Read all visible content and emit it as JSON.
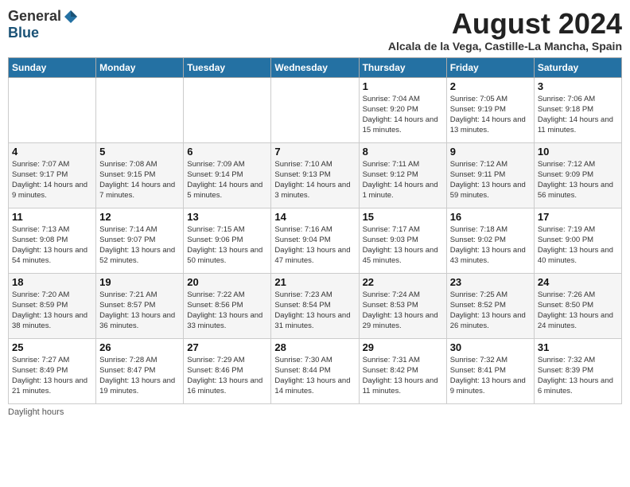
{
  "header": {
    "logo_general": "General",
    "logo_blue": "Blue",
    "month_title": "August 2024",
    "subtitle": "Alcala de la Vega, Castille-La Mancha, Spain"
  },
  "days_of_week": [
    "Sunday",
    "Monday",
    "Tuesday",
    "Wednesday",
    "Thursday",
    "Friday",
    "Saturday"
  ],
  "footer": {
    "note": "Daylight hours"
  },
  "weeks": [
    [
      {
        "day": "",
        "info": ""
      },
      {
        "day": "",
        "info": ""
      },
      {
        "day": "",
        "info": ""
      },
      {
        "day": "",
        "info": ""
      },
      {
        "day": "1",
        "info": "Sunrise: 7:04 AM\nSunset: 9:20 PM\nDaylight: 14 hours\nand 15 minutes."
      },
      {
        "day": "2",
        "info": "Sunrise: 7:05 AM\nSunset: 9:19 PM\nDaylight: 14 hours\nand 13 minutes."
      },
      {
        "day": "3",
        "info": "Sunrise: 7:06 AM\nSunset: 9:18 PM\nDaylight: 14 hours\nand 11 minutes."
      }
    ],
    [
      {
        "day": "4",
        "info": "Sunrise: 7:07 AM\nSunset: 9:17 PM\nDaylight: 14 hours\nand 9 minutes."
      },
      {
        "day": "5",
        "info": "Sunrise: 7:08 AM\nSunset: 9:15 PM\nDaylight: 14 hours\nand 7 minutes."
      },
      {
        "day": "6",
        "info": "Sunrise: 7:09 AM\nSunset: 9:14 PM\nDaylight: 14 hours\nand 5 minutes."
      },
      {
        "day": "7",
        "info": "Sunrise: 7:10 AM\nSunset: 9:13 PM\nDaylight: 14 hours\nand 3 minutes."
      },
      {
        "day": "8",
        "info": "Sunrise: 7:11 AM\nSunset: 9:12 PM\nDaylight: 14 hours\nand 1 minute."
      },
      {
        "day": "9",
        "info": "Sunrise: 7:12 AM\nSunset: 9:11 PM\nDaylight: 13 hours\nand 59 minutes."
      },
      {
        "day": "10",
        "info": "Sunrise: 7:12 AM\nSunset: 9:09 PM\nDaylight: 13 hours\nand 56 minutes."
      }
    ],
    [
      {
        "day": "11",
        "info": "Sunrise: 7:13 AM\nSunset: 9:08 PM\nDaylight: 13 hours\nand 54 minutes."
      },
      {
        "day": "12",
        "info": "Sunrise: 7:14 AM\nSunset: 9:07 PM\nDaylight: 13 hours\nand 52 minutes."
      },
      {
        "day": "13",
        "info": "Sunrise: 7:15 AM\nSunset: 9:06 PM\nDaylight: 13 hours\nand 50 minutes."
      },
      {
        "day": "14",
        "info": "Sunrise: 7:16 AM\nSunset: 9:04 PM\nDaylight: 13 hours\nand 47 minutes."
      },
      {
        "day": "15",
        "info": "Sunrise: 7:17 AM\nSunset: 9:03 PM\nDaylight: 13 hours\nand 45 minutes."
      },
      {
        "day": "16",
        "info": "Sunrise: 7:18 AM\nSunset: 9:02 PM\nDaylight: 13 hours\nand 43 minutes."
      },
      {
        "day": "17",
        "info": "Sunrise: 7:19 AM\nSunset: 9:00 PM\nDaylight: 13 hours\nand 40 minutes."
      }
    ],
    [
      {
        "day": "18",
        "info": "Sunrise: 7:20 AM\nSunset: 8:59 PM\nDaylight: 13 hours\nand 38 minutes."
      },
      {
        "day": "19",
        "info": "Sunrise: 7:21 AM\nSunset: 8:57 PM\nDaylight: 13 hours\nand 36 minutes."
      },
      {
        "day": "20",
        "info": "Sunrise: 7:22 AM\nSunset: 8:56 PM\nDaylight: 13 hours\nand 33 minutes."
      },
      {
        "day": "21",
        "info": "Sunrise: 7:23 AM\nSunset: 8:54 PM\nDaylight: 13 hours\nand 31 minutes."
      },
      {
        "day": "22",
        "info": "Sunrise: 7:24 AM\nSunset: 8:53 PM\nDaylight: 13 hours\nand 29 minutes."
      },
      {
        "day": "23",
        "info": "Sunrise: 7:25 AM\nSunset: 8:52 PM\nDaylight: 13 hours\nand 26 minutes."
      },
      {
        "day": "24",
        "info": "Sunrise: 7:26 AM\nSunset: 8:50 PM\nDaylight: 13 hours\nand 24 minutes."
      }
    ],
    [
      {
        "day": "25",
        "info": "Sunrise: 7:27 AM\nSunset: 8:49 PM\nDaylight: 13 hours\nand 21 minutes."
      },
      {
        "day": "26",
        "info": "Sunrise: 7:28 AM\nSunset: 8:47 PM\nDaylight: 13 hours\nand 19 minutes."
      },
      {
        "day": "27",
        "info": "Sunrise: 7:29 AM\nSunset: 8:46 PM\nDaylight: 13 hours\nand 16 minutes."
      },
      {
        "day": "28",
        "info": "Sunrise: 7:30 AM\nSunset: 8:44 PM\nDaylight: 13 hours\nand 14 minutes."
      },
      {
        "day": "29",
        "info": "Sunrise: 7:31 AM\nSunset: 8:42 PM\nDaylight: 13 hours\nand 11 minutes."
      },
      {
        "day": "30",
        "info": "Sunrise: 7:32 AM\nSunset: 8:41 PM\nDaylight: 13 hours\nand 9 minutes."
      },
      {
        "day": "31",
        "info": "Sunrise: 7:32 AM\nSunset: 8:39 PM\nDaylight: 13 hours\nand 6 minutes."
      }
    ]
  ]
}
